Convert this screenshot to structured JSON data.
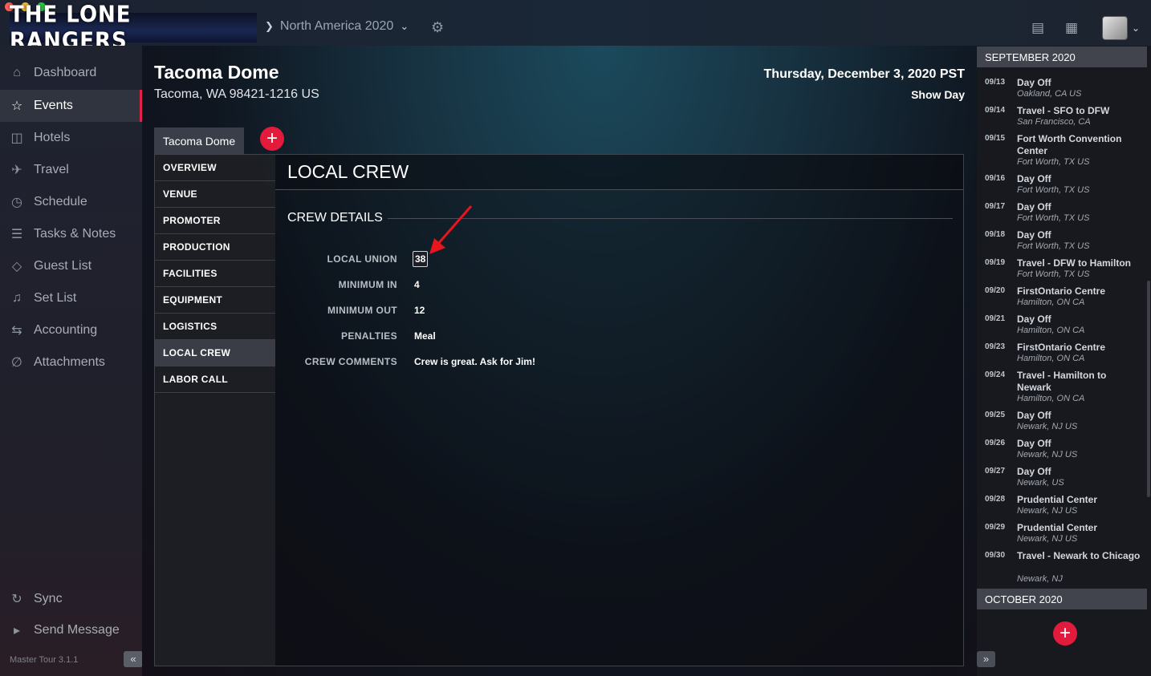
{
  "app": {
    "band_name": "THE LONE RANGERS",
    "tour": "North America 2020",
    "version": "Master Tour 3.1.1"
  },
  "sidebar": {
    "items": [
      {
        "label": "Dashboard",
        "icon": "home-icon"
      },
      {
        "label": "Events",
        "icon": "star-icon"
      },
      {
        "label": "Hotels",
        "icon": "hotel-icon"
      },
      {
        "label": "Travel",
        "icon": "plane-icon"
      },
      {
        "label": "Schedule",
        "icon": "clock-icon"
      },
      {
        "label": "Tasks & Notes",
        "icon": "list-icon"
      },
      {
        "label": "Guest List",
        "icon": "ticket-icon"
      },
      {
        "label": "Set List",
        "icon": "music-icon"
      },
      {
        "label": "Accounting",
        "icon": "money-icon"
      },
      {
        "label": "Attachments",
        "icon": "paperclip-icon"
      }
    ],
    "bottom": [
      {
        "label": "Sync",
        "icon": "sync-icon"
      },
      {
        "label": "Send Message",
        "icon": "megaphone-icon"
      }
    ],
    "active": "Events"
  },
  "event": {
    "venue": "Tacoma Dome",
    "address": "Tacoma, WA 98421-1216 US",
    "date": "Thursday, December 3, 2020 PST",
    "day_type": "Show Day",
    "tab": "Tacoma Dome"
  },
  "subnav": [
    "OVERVIEW",
    "VENUE",
    "PROMOTER",
    "PRODUCTION",
    "FACILITIES",
    "EQUIPMENT",
    "LOGISTICS",
    "LOCAL CREW",
    "LABOR CALL"
  ],
  "subnav_active": "LOCAL CREW",
  "section": {
    "title": "LOCAL CREW",
    "subtitle": "CREW DETAILS",
    "fields": [
      {
        "label": "LOCAL UNION",
        "value": "38"
      },
      {
        "label": "MINIMUM IN",
        "value": "4"
      },
      {
        "label": "MINIMUM OUT",
        "value": "12"
      },
      {
        "label": "PENALTIES",
        "value": "Meal"
      },
      {
        "label": "CREW COMMENTS",
        "value": "Crew is great. Ask for Jim!"
      }
    ]
  },
  "schedule": {
    "month1": "SEPTEMBER 2020",
    "month2": "OCTOBER 2020",
    "items": [
      {
        "date": "09/13",
        "title": "Day Off",
        "location": "Oakland, CA US"
      },
      {
        "date": "09/14",
        "title": "Travel - SFO to DFW",
        "location": "San Francisco, CA"
      },
      {
        "date": "09/15",
        "title": "Fort Worth Convention Center",
        "location": "Fort Worth, TX US"
      },
      {
        "date": "09/16",
        "title": "Day Off",
        "location": "Fort Worth, TX US"
      },
      {
        "date": "09/17",
        "title": "Day Off",
        "location": "Fort Worth, TX US"
      },
      {
        "date": "09/18",
        "title": "Day Off",
        "location": "Fort Worth, TX US"
      },
      {
        "date": "09/19",
        "title": "Travel - DFW to Hamilton",
        "location": "Fort Worth, TX US"
      },
      {
        "date": "09/20",
        "title": "FirstOntario Centre",
        "location": "Hamilton, ON CA"
      },
      {
        "date": "09/21",
        "title": "Day Off",
        "location": "Hamilton, ON CA"
      },
      {
        "date": "09/23",
        "title": "FirstOntario Centre",
        "location": "Hamilton, ON CA"
      },
      {
        "date": "09/24",
        "title": "Travel - Hamilton to Newark",
        "location": "Hamilton, ON CA"
      },
      {
        "date": "09/25",
        "title": "Day Off",
        "location": "Newark, NJ US"
      },
      {
        "date": "09/26",
        "title": "Day Off",
        "location": "Newark, NJ US"
      },
      {
        "date": "09/27",
        "title": "Day Off",
        "location": "Newark, US"
      },
      {
        "date": "09/28",
        "title": "Prudential Center",
        "location": "Newark, NJ US"
      },
      {
        "date": "09/29",
        "title": "Prudential Center",
        "location": "Newark, NJ US"
      },
      {
        "date": "09/30",
        "title": "Travel - Newark to Chicago",
        "location": "Newark, NJ"
      }
    ]
  },
  "colors": {
    "accent": "#e21b3c",
    "active_bg": "#30343f"
  }
}
